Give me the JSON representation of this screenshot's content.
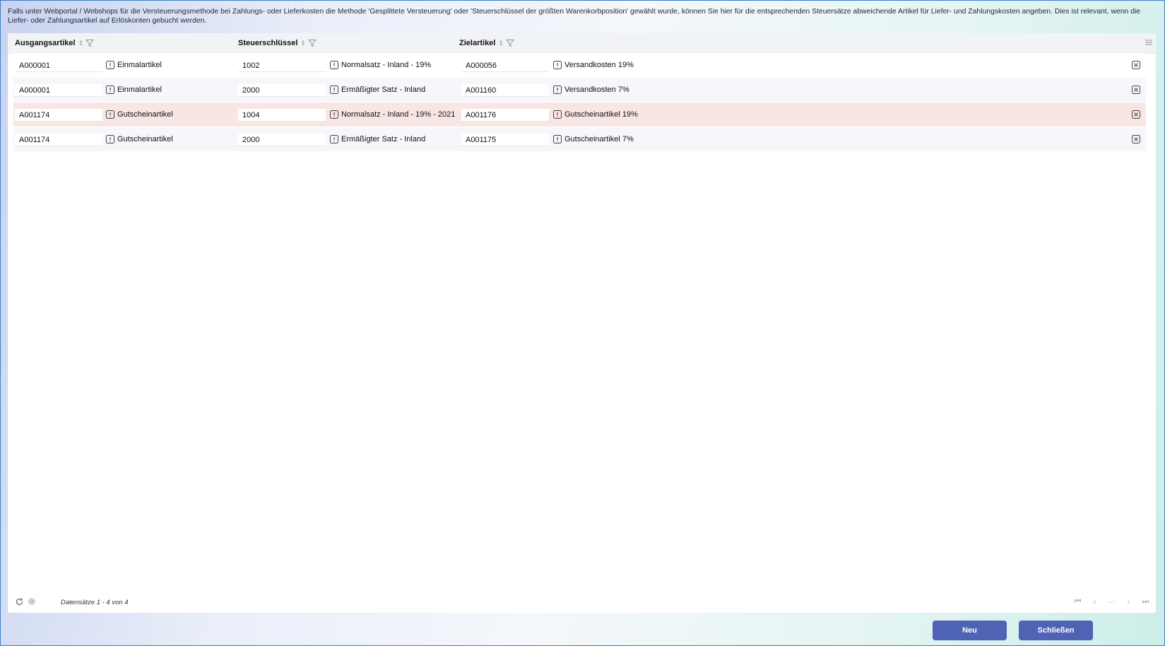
{
  "info_text": "Falls unter Webportal / Webshops für die Versteuerungsmethode bei Zahlungs- oder Lieferkosten die Methode 'Gesplittete Versteuerung' oder 'Steuerschlüssel der größten Warenkorbposition' gewählt wurde, können Sie hier für die entsprechenden Steuersätze abweichende Artikel für Liefer- und Zahlungskosten angeben. Dies ist relevant, wenn die Liefer- oder Zahlungsartikel auf Erlöskonten gebucht werden.",
  "columns": {
    "source": "Ausgangsartikel",
    "taxkey": "Steuerschlüssel",
    "target": "Zielartikel"
  },
  "rows": [
    {
      "source_no": "A000001",
      "source_name": "Einmalartikel",
      "tax_no": "1002",
      "tax_name": "Normalsatz - Inland - 19%",
      "target_no": "A000056",
      "target_name": "Versandkosten 19%"
    },
    {
      "source_no": "A000001",
      "source_name": "Einmalartikel",
      "tax_no": "2000",
      "tax_name": "Ermäßigter Satz - Inland",
      "target_no": "A001160",
      "target_name": "Versandkosten 7%"
    },
    {
      "source_no": "A001174",
      "source_name": "Gutscheinartikel",
      "tax_no": "1004",
      "tax_name": "Normalsatz - Inland - 19% - 2021",
      "target_no": "A001176",
      "target_name": "Gutscheinartikel 19%"
    },
    {
      "source_no": "A001174",
      "source_name": "Gutscheinartikel",
      "tax_no": "2000",
      "tax_name": "Ermäßigter Satz - Inland",
      "target_no": "A001175",
      "target_name": "Gutscheinartikel 7%"
    }
  ],
  "selected_row": 2,
  "footer": {
    "records": "Datensätze 1 - 4 von 4",
    "pager_ellipsis": "···"
  },
  "buttons": {
    "new": "Neu",
    "close": "Schließen"
  },
  "colors": {
    "accent": "#4f63b4",
    "selected_row": "#f8e6e4",
    "window_border": "#3e7fc7"
  }
}
